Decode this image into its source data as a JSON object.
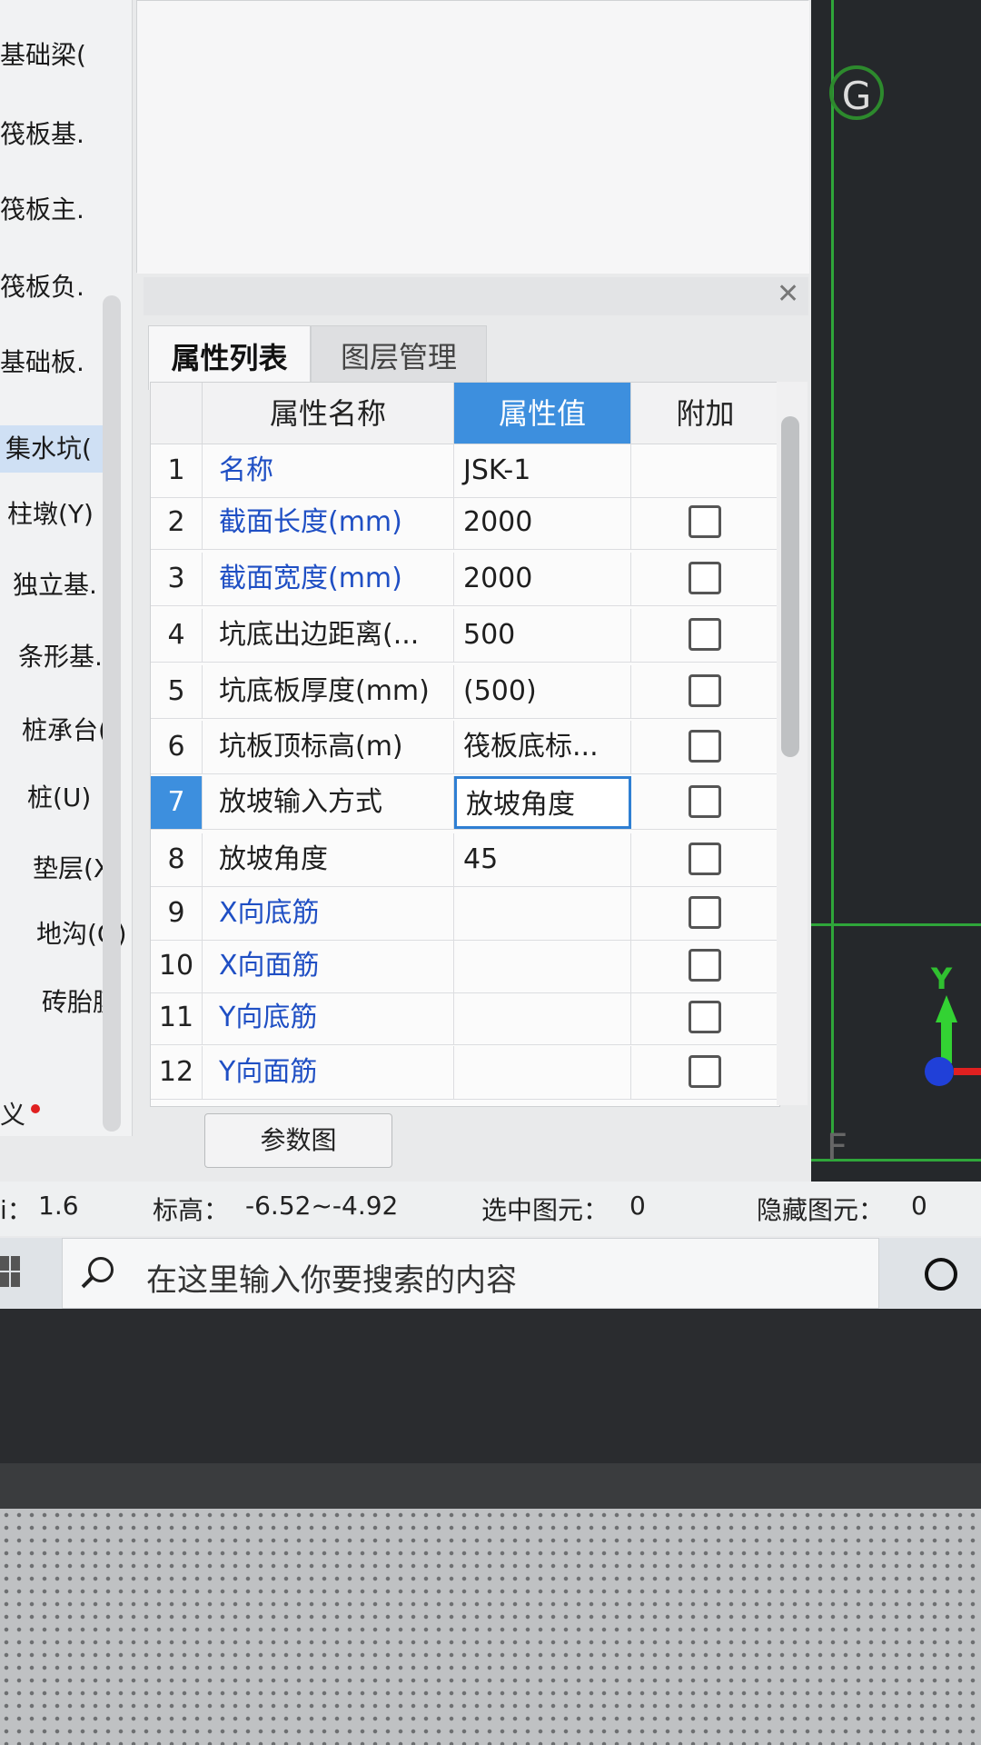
{
  "left_panel": {
    "items": [
      {
        "label": "基础梁(",
        "selected": false
      },
      {
        "label": "筏板基.",
        "selected": false
      },
      {
        "label": "筏板主.",
        "selected": false
      },
      {
        "label": "筏板负.",
        "selected": false
      },
      {
        "label": "基础板.",
        "selected": false
      },
      {
        "label": "集水坑(",
        "selected": true
      },
      {
        "label": "柱墩(Y)",
        "selected": false
      },
      {
        "label": "独立基.",
        "selected": false
      },
      {
        "label": "条形基.",
        "selected": false
      },
      {
        "label": "桩承台(",
        "selected": false
      },
      {
        "label": "桩(U)",
        "selected": false
      },
      {
        "label": "垫层(X)",
        "selected": false
      },
      {
        "label": "地沟(G)",
        "selected": false
      },
      {
        "label": "砖胎膜",
        "selected": false
      }
    ],
    "bottom_label": "义"
  },
  "property_panel": {
    "tabs": [
      {
        "label": "属性列表",
        "active": true
      },
      {
        "label": "图层管理",
        "active": false
      }
    ],
    "columns": {
      "name": "属性名称",
      "value": "属性值",
      "extra": "附加"
    },
    "rows": [
      {
        "num": "1",
        "name": "名称",
        "value": "JSK-1",
        "color": "blue",
        "checkbox": false
      },
      {
        "num": "2",
        "name": "截面长度(mm)",
        "value": "2000",
        "color": "blue",
        "checkbox": true
      },
      {
        "num": "3",
        "name": "截面宽度(mm)",
        "value": "2000",
        "color": "blue",
        "checkbox": true
      },
      {
        "num": "4",
        "name": "坑底出边距离(...",
        "value": "500",
        "color": "dark",
        "checkbox": true
      },
      {
        "num": "5",
        "name": "坑底板厚度(mm)",
        "value": "(500)",
        "color": "dark",
        "checkbox": true
      },
      {
        "num": "6",
        "name": "坑板顶标高(m)",
        "value": "筏板底标...",
        "color": "dark",
        "checkbox": true
      },
      {
        "num": "7",
        "name": "放坡输入方式",
        "value": "放坡角度",
        "color": "dark",
        "checkbox": true,
        "selected": true
      },
      {
        "num": "8",
        "name": "放坡角度",
        "value": "45",
        "color": "dark",
        "checkbox": true
      },
      {
        "num": "9",
        "name": "X向底筋",
        "value": "",
        "color": "blue",
        "checkbox": true
      },
      {
        "num": "10",
        "name": "X向面筋",
        "value": "",
        "color": "blue",
        "checkbox": true
      },
      {
        "num": "11",
        "name": "Y向底筋",
        "value": "",
        "color": "blue",
        "checkbox": true
      },
      {
        "num": "12",
        "name": "Y向面筋",
        "value": "",
        "color": "blue",
        "checkbox": true
      }
    ],
    "param_button": "参数图",
    "close_icon": "close-icon"
  },
  "viewport": {
    "axis_label": "G",
    "y_axis_label": "Y",
    "bottom_label": "F"
  },
  "status_bar": {
    "scale_label": "i：",
    "scale_value": "1.6",
    "elevation_label": "标高：",
    "elevation_value": "-6.52~-4.92",
    "selected_label": "选中图元：",
    "selected_value": "0",
    "hidden_label": "隐藏图元：",
    "hidden_value": "0"
  },
  "taskbar": {
    "search_placeholder": "在这里输入你要搜索的内容"
  },
  "colors": {
    "header_highlight": "#3d8fde",
    "blue_text": "#1f4fc4",
    "grid_green": "#2fa63a"
  }
}
